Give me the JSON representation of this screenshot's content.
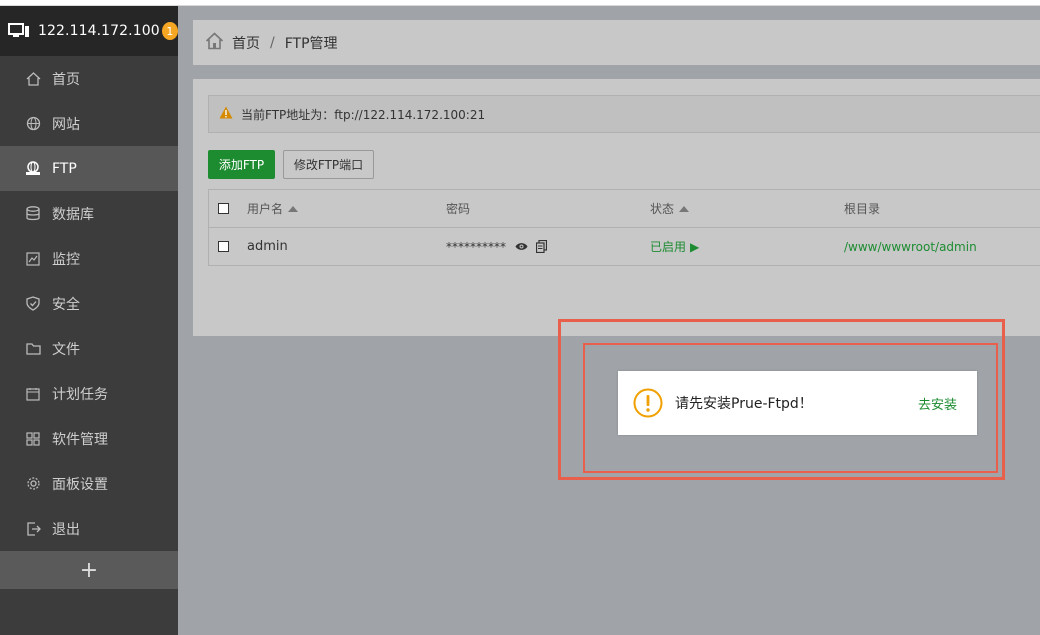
{
  "sidebar": {
    "server_ip": "122.114.172.100",
    "badge": "1",
    "items": [
      {
        "label": "首页",
        "icon": "home-icon"
      },
      {
        "label": "网站",
        "icon": "globe-icon"
      },
      {
        "label": "FTP",
        "icon": "ftp-icon",
        "active": true
      },
      {
        "label": "数据库",
        "icon": "database-icon"
      },
      {
        "label": "监控",
        "icon": "monitor-icon"
      },
      {
        "label": "安全",
        "icon": "shield-icon"
      },
      {
        "label": "文件",
        "icon": "folder-icon"
      },
      {
        "label": "计划任务",
        "icon": "calendar-icon"
      },
      {
        "label": "软件管理",
        "icon": "grid-icon"
      },
      {
        "label": "面板设置",
        "icon": "gear-icon"
      },
      {
        "label": "退出",
        "icon": "logout-icon"
      }
    ],
    "add_label": "+"
  },
  "breadcrumb": {
    "home": "首页",
    "separator": "/",
    "current": "FTP管理"
  },
  "alert": {
    "text": "当前FTP地址为：ftp://122.114.172.100:21"
  },
  "toolbar": {
    "add_label": "添加FTP",
    "port_label": "修改FTP端口"
  },
  "table": {
    "headers": [
      "用户名",
      "密码",
      "状态",
      "根目录"
    ],
    "rows": [
      {
        "username": "admin",
        "password": "**********",
        "status": "已启用",
        "status_arrow": "▶",
        "root": "/www/wwwroot/admin"
      }
    ]
  },
  "toast": {
    "message": "请先安装Prue-Ftpd！",
    "action": "去安装"
  },
  "colors": {
    "accent": "#1d8c31",
    "warning": "#f5a623",
    "highlight": "#e8604c"
  }
}
